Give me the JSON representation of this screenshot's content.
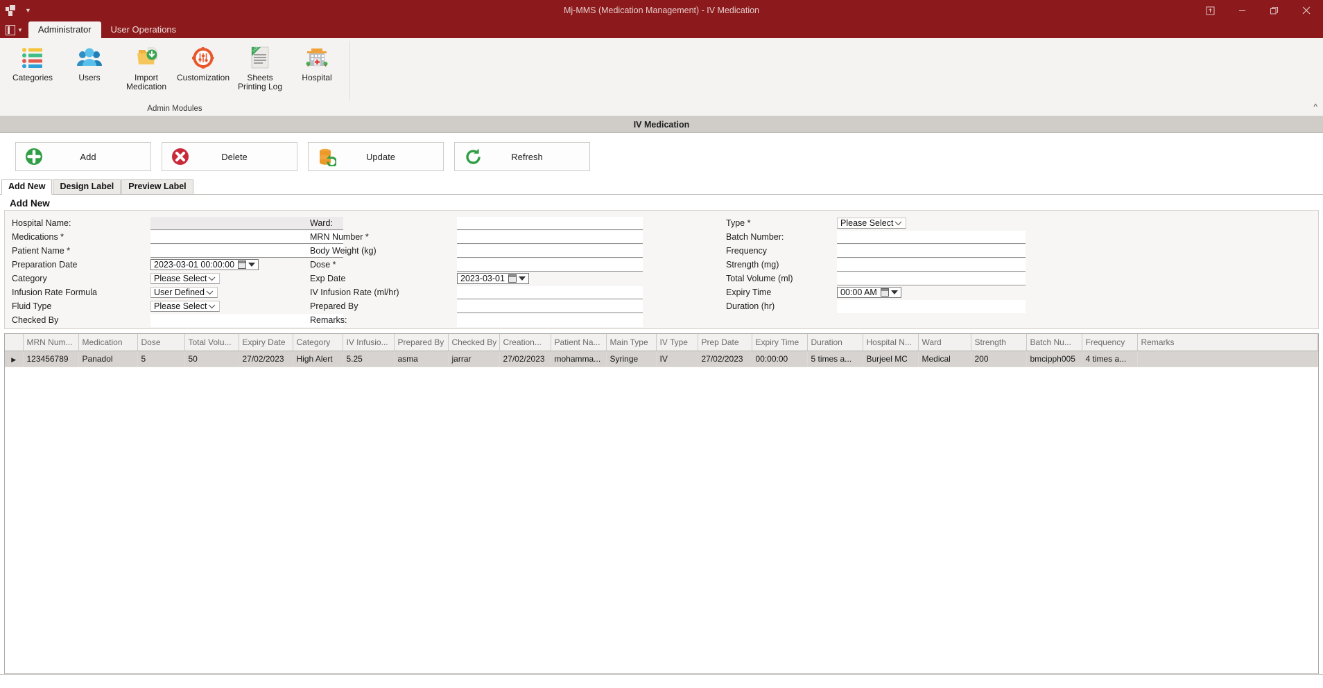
{
  "titlebar": {
    "title": "Mj-MMS (Medication Management) - IV Medication",
    "quick_access_icon": "app-icon",
    "controls": {
      "restore_down_label": "Restore Down",
      "minimize_label": "Minimize",
      "maximize_label": "Maximize",
      "close_label": "Close"
    }
  },
  "ribbon": {
    "file_menu_label": "File",
    "tabs": [
      {
        "label": "Administrator",
        "active": true
      },
      {
        "label": "User Operations",
        "active": false
      }
    ],
    "groups": [
      {
        "title": "Admin Modules",
        "buttons": [
          {
            "label": "Categories",
            "icon": "list-icon"
          },
          {
            "label": "Users",
            "icon": "users-icon"
          },
          {
            "label": "Import\nMedication",
            "line1": "Import",
            "line2": "Medication",
            "icon": "import-folder-icon"
          },
          {
            "label": "Customization",
            "icon": "gear-sliders-icon"
          },
          {
            "label": "Sheets\nPrinting Log",
            "line1": "Sheets",
            "line2": "Printing Log",
            "icon": "document-log-icon"
          },
          {
            "label": "Hospital",
            "icon": "hospital-icon"
          }
        ]
      }
    ],
    "collapse_icon": "chevron-up-icon"
  },
  "page": {
    "caption": "IV Medication"
  },
  "actions": [
    {
      "label": "Add",
      "icon": "plus-circle-icon",
      "color": "#2f9e44"
    },
    {
      "label": "Delete",
      "icon": "x-circle-icon",
      "color": "#c92a3a"
    },
    {
      "label": "Update",
      "icon": "database-refresh-icon",
      "color": "#e8962f"
    },
    {
      "label": "Refresh",
      "icon": "refresh-icon",
      "color": "#2f9e44"
    }
  ],
  "tabs": [
    {
      "label": "Add New",
      "active": true
    },
    {
      "label": "Design Label",
      "active": false
    },
    {
      "label": "Preview Label",
      "active": false
    }
  ],
  "form": {
    "legend": "Add New",
    "col1": [
      {
        "label": "Hospital Name:",
        "type": "readonly",
        "value": ""
      },
      {
        "label": "Medications *",
        "type": "text",
        "value": ""
      },
      {
        "label": "Patient Name *",
        "type": "text",
        "value": ""
      },
      {
        "label": "Preparation Date",
        "type": "datetime",
        "value": "2023-03-01 00:00:00"
      },
      {
        "label": "Category",
        "type": "combo",
        "value": "Please Select"
      },
      {
        "label": "Infusion Rate Formula",
        "type": "combo",
        "value": "User Defined"
      },
      {
        "label": "Fluid Type",
        "type": "combo",
        "value": "Please Select"
      },
      {
        "label": "Checked By",
        "type": "text",
        "value": ""
      }
    ],
    "col2": [
      {
        "label": "Ward:",
        "type": "text",
        "value": ""
      },
      {
        "label": "MRN Number *",
        "type": "text",
        "value": ""
      },
      {
        "label": "Body Weight (kg)",
        "type": "text",
        "value": ""
      },
      {
        "label": "Dose *",
        "type": "text",
        "value": ""
      },
      {
        "label": "Exp Date",
        "type": "datetime",
        "value": "2023-03-01"
      },
      {
        "label": "IV Infusion Rate (ml/hr)",
        "type": "text",
        "value": ""
      },
      {
        "label": "Prepared By",
        "type": "text",
        "value": ""
      },
      {
        "label": "Remarks:",
        "type": "text",
        "value": ""
      }
    ],
    "col3": [
      {
        "label": "Type *",
        "type": "combo",
        "value": "Please Select"
      },
      {
        "label": "Batch Number:",
        "type": "text",
        "value": ""
      },
      {
        "label": "Frequency",
        "type": "text",
        "value": ""
      },
      {
        "label": "Strength (mg)",
        "type": "text",
        "value": ""
      },
      {
        "label": "Total Volume (ml)",
        "type": "text",
        "value": ""
      },
      {
        "label": "Expiry Time",
        "type": "datetime",
        "value": "00:00 AM"
      },
      {
        "label": "Duration (hr)",
        "type": "text",
        "value": ""
      }
    ]
  },
  "grid": {
    "columns": [
      "MRN Num...",
      "Medication",
      "Dose",
      "Total Volu...",
      "Expiry Date",
      "Category",
      "IV Infusio...",
      "Prepared By",
      "Checked By",
      "Creation...",
      "Patient Na...",
      "Main Type",
      "IV Type",
      "Prep Date",
      "Expiry Time",
      "Duration",
      "Hospital N...",
      "Ward",
      "Strength",
      "Batch Nu...",
      "Frequency",
      "Remarks"
    ],
    "rows": [
      {
        "selected": true,
        "cells": [
          "123456789",
          "Panadol",
          "5",
          "50",
          "27/02/2023",
          "High Alert",
          "5.25",
          "asma",
          "jarrar",
          "27/02/2023",
          "mohamma...",
          "Syringe",
          "IV",
          "27/02/2023",
          "00:00:00",
          "5 times a...",
          "Burjeel MC",
          "Medical",
          "200",
          "bmcipph005",
          "4 times a...",
          ""
        ]
      }
    ]
  }
}
